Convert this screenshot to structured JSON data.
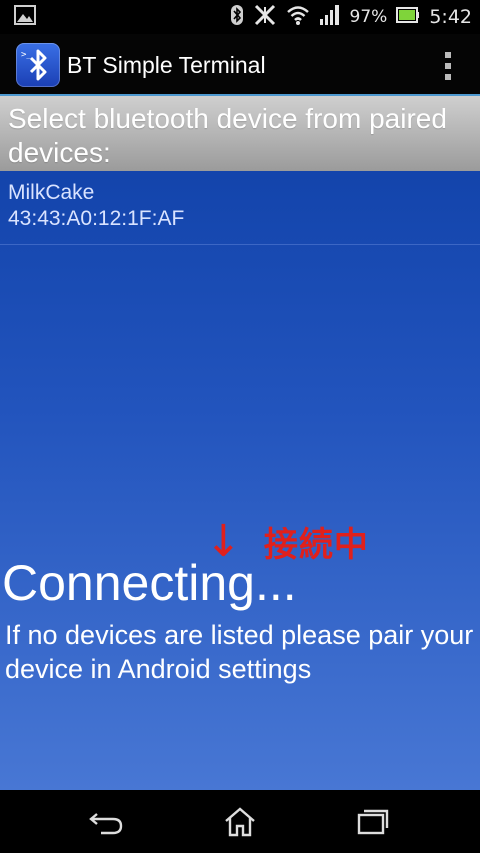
{
  "status_bar": {
    "battery_percent": "97%",
    "time": "5:42",
    "icons": [
      "image-icon",
      "bluetooth-icon",
      "nfc-icon",
      "wifi-icon",
      "signal-icon",
      "battery-icon"
    ]
  },
  "action_bar": {
    "title": "BT Simple Terminal",
    "icon": "bluetooth-terminal-app-icon",
    "menu_icon": "overflow-menu-icon"
  },
  "device_list": {
    "header": "Select bluetooth device from paired devices:",
    "devices": [
      {
        "name": "MilkCake",
        "address": "43:43:A0:12:1F:AF"
      }
    ]
  },
  "annotation": {
    "arrow": "↓",
    "text": "接続中",
    "color": "#e0201c"
  },
  "status": {
    "connecting": "Connecting...",
    "help": "If no devices are listed please pair your device in Android settings"
  },
  "nav_bar": {
    "buttons": [
      "back-icon",
      "home-icon",
      "recent-apps-icon"
    ]
  },
  "colors": {
    "content_top": "#0e3fa6",
    "content_bottom": "#4877d4",
    "header_gray": "#b5b5b5",
    "action_divider": "#4d98cf"
  }
}
